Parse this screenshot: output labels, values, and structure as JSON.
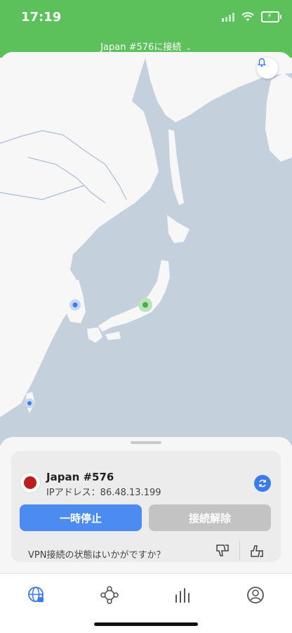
{
  "status": {
    "time": "17:19"
  },
  "header": {
    "title": "Japan #576に接続"
  },
  "connection": {
    "server_name": "Japan #576",
    "ip_label": "IPアドレス：86.48.13.199",
    "pause_label": "一時停止",
    "disconnect_label": "接続解除",
    "rating_prompt": "VPN接続の状態はいかがですか？"
  },
  "colors": {
    "brand_green": "#5dc15b",
    "accent_blue": "#4c8cf0",
    "disabled_gray": "#c3c3c3",
    "map_water": "#c4d0dc",
    "map_land": "#f7f7f7",
    "flag_red": "#bc1e1e"
  },
  "icons": {
    "bell": "bell-icon",
    "refresh": "refresh-icon",
    "thumbs_down": "thumbs-down-icon",
    "thumbs_up": "thumbs-up-icon",
    "tab_vpn": "globe-lock-icon",
    "tab_meshnet": "meshnet-icon",
    "tab_stats": "bar-chart-icon",
    "tab_profile": "profile-icon"
  }
}
